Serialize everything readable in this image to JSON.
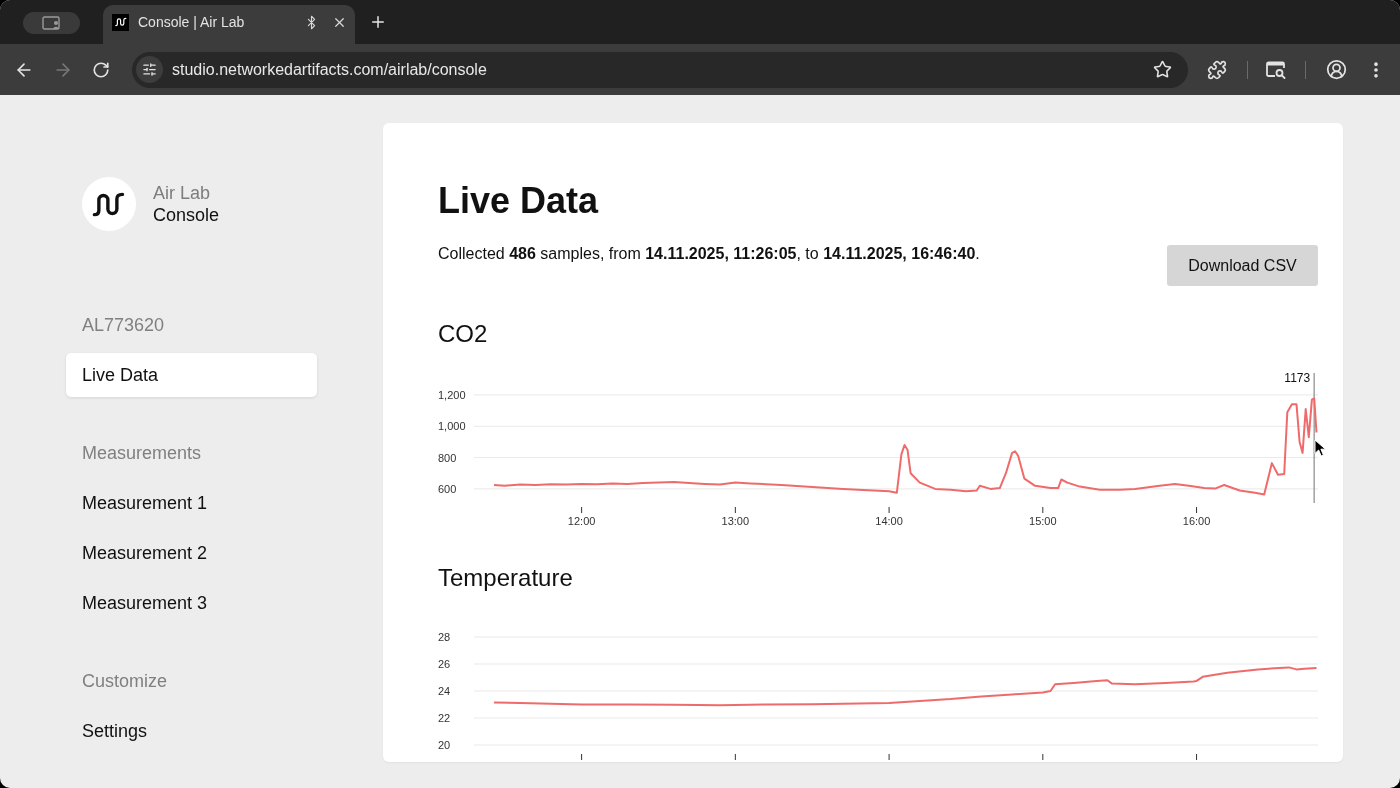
{
  "browser": {
    "tabs": [
      {
        "title": "Console | Air Lab",
        "selected": true
      }
    ],
    "forward_button": {
      "disabled": true
    },
    "address_bar": {
      "url": "studio.networkedartifacts.com/airlab/console"
    }
  },
  "sidebar": {
    "brand": {
      "line_1": "Air Lab",
      "line_2": "Console"
    },
    "sections": [
      {
        "heading": "AL773620",
        "items": [
          {
            "label": "Live Data",
            "selected": true
          }
        ]
      },
      {
        "heading": "Measurements",
        "items": [
          {
            "label": "Measurement 1",
            "selected": false
          },
          {
            "label": "Measurement 2",
            "selected": false
          },
          {
            "label": "Measurement 3",
            "selected": false
          }
        ]
      },
      {
        "heading": "Customize",
        "items": [
          {
            "label": "Settings",
            "selected": false
          }
        ]
      }
    ]
  },
  "main": {
    "title": "Live Data",
    "summary": "Collected **486** samples, from **14.11.2025, 11:26:05**, to **14.11.2025, 16:46:40**.",
    "download_button": "Download CSV",
    "charts": [
      {
        "chart_data": {
          "type": "line",
          "title": "CO2",
          "x": [
            11.43,
            11.5,
            11.6,
            11.7,
            11.8,
            11.9,
            12.0,
            12.1,
            12.2,
            12.3,
            12.4,
            12.5,
            12.6,
            12.7,
            12.8,
            12.9,
            13.0,
            13.1,
            13.2,
            13.3,
            13.4,
            13.5,
            13.6,
            13.7,
            13.8,
            13.9,
            14.0,
            14.05,
            14.08,
            14.1,
            14.12,
            14.14,
            14.2,
            14.3,
            14.4,
            14.5,
            14.57,
            14.59,
            14.66,
            14.72,
            14.76,
            14.8,
            14.82,
            14.84,
            14.88,
            14.95,
            15.05,
            15.1,
            15.12,
            15.16,
            15.24,
            15.37,
            15.5,
            15.6,
            15.76,
            15.86,
            15.95,
            16.05,
            16.12,
            16.18,
            16.28,
            16.38,
            16.44,
            16.49,
            16.53,
            16.57,
            16.59,
            16.62,
            16.65,
            16.67,
            16.69,
            16.71,
            16.73,
            16.75,
            16.765,
            16.78
          ],
          "series": [
            {
              "color": "#ef6b6b",
              "values": [
                625,
                620,
                628,
                625,
                630,
                628,
                632,
                630,
                635,
                632,
                638,
                640,
                645,
                638,
                632,
                628,
                640,
                635,
                630,
                625,
                618,
                612,
                605,
                600,
                595,
                590,
                585,
                575,
                820,
                880,
                850,
                700,
                640,
                600,
                595,
                585,
                590,
                620,
                600,
                605,
                700,
                830,
                840,
                810,
                665,
                620,
                605,
                605,
                660,
                640,
                615,
                595,
                595,
                600,
                620,
                632,
                620,
                605,
                602,
                625,
                590,
                575,
                565,
                765,
                690,
                695,
                1090,
                1140,
                1140,
                900,
                830,
                1110,
                930,
                1170,
                1178,
                960
              ]
            }
          ],
          "xlim": [
            11.3,
            16.79
          ],
          "ylim": [
            510,
            1340
          ],
          "grid": true,
          "xticks": [
            {
              "value": 12,
              "label": "12:00"
            },
            {
              "value": 13,
              "label": "13:00"
            },
            {
              "value": 14,
              "label": "14:00"
            },
            {
              "value": 15,
              "label": "15:00"
            },
            {
              "value": 16,
              "label": "16:00"
            }
          ],
          "yticks": [
            {
              "value": 600,
              "label": "600"
            },
            {
              "value": 800,
              "label": "800"
            },
            {
              "value": 1000,
              "label": "1,000"
            },
            {
              "value": 1200,
              "label": "1,200"
            }
          ],
          "ref_lines": [
            {
              "axis": "x",
              "value": 16.765
            }
          ],
          "annotations": [
            "1173"
          ]
        }
      },
      {
        "chart_data": {
          "type": "line",
          "title": "Temperature",
          "x": [
            11.43,
            11.6,
            11.8,
            12.0,
            12.3,
            12.6,
            12.9,
            13.2,
            13.5,
            13.8,
            14.0,
            14.2,
            14.4,
            14.6,
            14.8,
            15.0,
            15.05,
            15.08,
            15.2,
            15.35,
            15.42,
            15.45,
            15.6,
            15.8,
            15.98,
            16.0,
            16.04,
            16.2,
            16.4,
            16.6,
            16.65,
            16.7,
            16.78
          ],
          "series": [
            {
              "color": "#ef6b6b",
              "values": [
                23.15,
                23.1,
                23.05,
                23.0,
                23.0,
                22.98,
                22.95,
                23.0,
                23.02,
                23.08,
                23.12,
                23.25,
                23.4,
                23.6,
                23.75,
                23.9,
                24.0,
                24.5,
                24.6,
                24.75,
                24.8,
                24.55,
                24.5,
                24.6,
                24.7,
                24.75,
                25.05,
                25.35,
                25.6,
                25.75,
                25.6,
                25.65,
                25.7
              ]
            }
          ],
          "xlim": [
            11.3,
            16.79
          ],
          "ylim": [
            20,
            28
          ],
          "grid": true,
          "yticks": [
            {
              "value": 20,
              "label": "20"
            },
            {
              "value": 22,
              "label": "22"
            },
            {
              "value": 24,
              "label": "24"
            },
            {
              "value": 26,
              "label": "26"
            },
            {
              "value": 28,
              "label": "28"
            }
          ]
        }
      }
    ]
  }
}
